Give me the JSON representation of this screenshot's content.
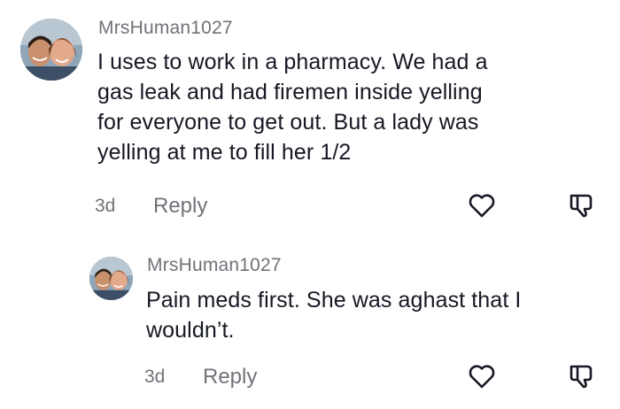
{
  "comments": [
    {
      "username": "MrsHuman1027",
      "lines": [
        "I uses to work in a pharmacy. We had a",
        "gas leak and had firemen inside yelling",
        "for everyone to get out. But a lady was",
        "yelling at me to fill her 1/2"
      ],
      "time": "3d",
      "reply_label": "Reply"
    },
    {
      "username": "MrsHuman1027",
      "lines": [
        "Pain meds first. She was aghast that I",
        "wouldn’t."
      ],
      "time": "3d",
      "reply_label": "Reply"
    }
  ],
  "icons": {
    "like": "heart-outline-icon",
    "dislike": "thumbs-down-outline-icon"
  },
  "colors": {
    "text": "#161823",
    "muted": "#6f7278"
  }
}
